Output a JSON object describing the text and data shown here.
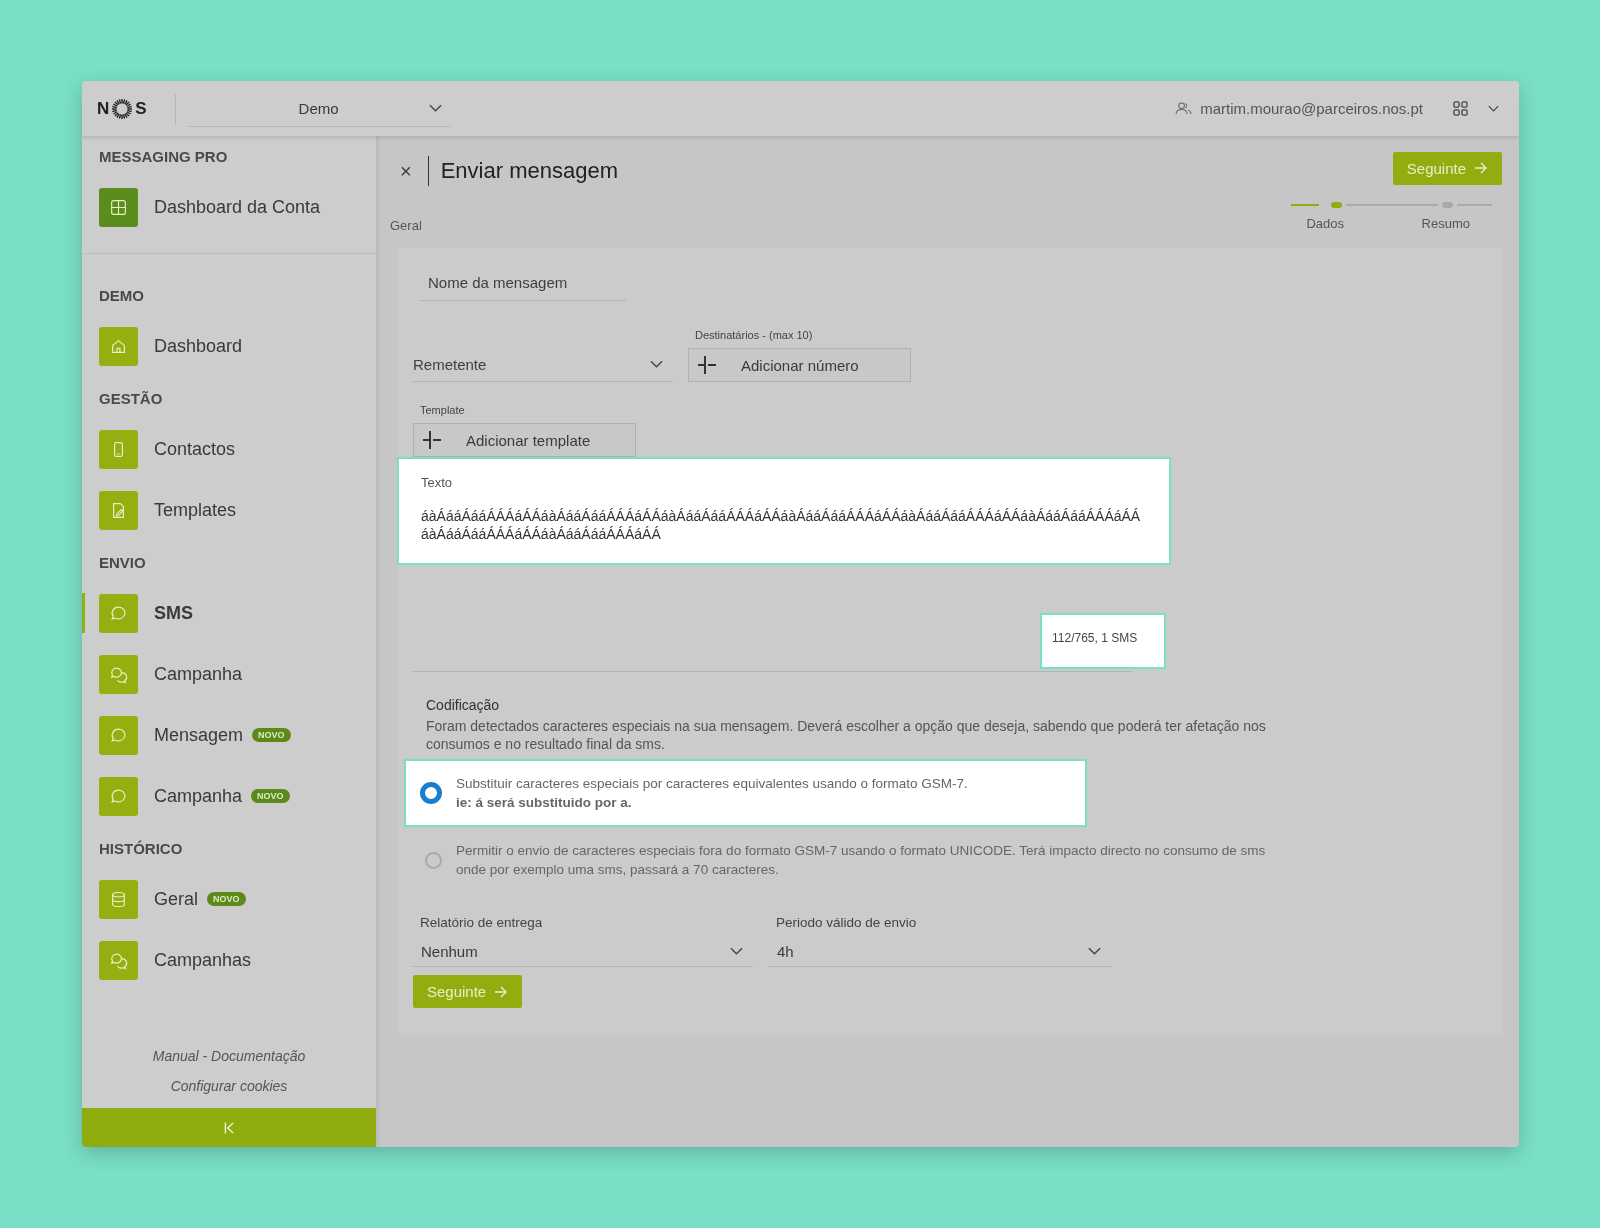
{
  "header": {
    "logo": {
      "left": "N",
      "right": "S"
    },
    "account_select": {
      "value": "Demo"
    },
    "user_email": "martim.mourao@parceiros.nos.pt"
  },
  "sidebar": {
    "sections": [
      {
        "title": "MESSAGING PRO",
        "items": [
          {
            "label": "Dashboard da Conta",
            "selected": false,
            "color": "#5b8c1e"
          }
        ]
      },
      {
        "title": "DEMO",
        "items": [
          {
            "label": "Dashboard",
            "selected": false,
            "color": "#94b010"
          }
        ]
      },
      {
        "title": "GESTÃO",
        "items": [
          {
            "label": "Contactos",
            "selected": false,
            "color": "#94b010"
          },
          {
            "label": "Templates",
            "selected": false,
            "color": "#94b010"
          }
        ]
      },
      {
        "title": "ENVIO",
        "items": [
          {
            "label": "SMS",
            "selected": true,
            "color": "#94b010"
          },
          {
            "label": "Campanha",
            "selected": false,
            "color": "#94b010"
          },
          {
            "label": "Mensagem",
            "badge": "NOVO",
            "selected": false,
            "color": "#94b010"
          },
          {
            "label": "Campanha",
            "badge": "NOVO",
            "selected": false,
            "color": "#94b010"
          }
        ]
      },
      {
        "title": "HISTÓRICO",
        "items": [
          {
            "label": "Geral",
            "badge": "NOVO",
            "selected": false,
            "color": "#94b010"
          },
          {
            "label": "Campanhas",
            "selected": false,
            "color": "#94b010"
          }
        ]
      }
    ],
    "footer_links": [
      "Manual - Documentação",
      "Configurar cookies"
    ]
  },
  "page": {
    "close_glyph": "×",
    "title": "Enviar mensagem",
    "next_button": "Seguinte",
    "steps": [
      {
        "label": "Geral",
        "done": true,
        "active": false
      },
      {
        "label": "Dados",
        "done": false,
        "active": true
      },
      {
        "label": "Resumo",
        "done": false,
        "active": false
      }
    ]
  },
  "form": {
    "name_field": {
      "placeholder": "Nome da mensagem"
    },
    "sender_select": {
      "placeholder": "Remetente"
    },
    "recipients": {
      "label": "Destinatários - (max 10)",
      "button": "Adicionar número"
    },
    "template": {
      "label": "Template",
      "button": "Adicionar template"
    },
    "text": {
      "label": "Texto",
      "value": "áàÁááÁááÁÁÁáÁÁáàÁááÁááÁÁÁáÁÁáàÁááÁááÁÁÁáÁÁáàÁááÁááÁÁÁáÁÁáàÁááÁááÁÁÁáÁÁáàÁááÁááÁÁÁáÁÁáàÁááÁááÁÁÁáÁÁáàÁááÁááÁÁÁáÁÁ",
      "highlighted": true
    },
    "counter": {
      "text": "112/765, 1 SMS",
      "highlighted": true
    },
    "encoding": {
      "title": "Codificação",
      "description": "Foram detectados caracteres especiais na sua mensagem. Deverá escolher a opção que deseja, sabendo que poderá ter afetação nos consumos e no resultado final da sms.",
      "options": [
        {
          "text": "Substituir caracteres especiais por caracteres equivalentes usando o formato GSM-7.",
          "note": "ie: á será substituido por a.",
          "selected": true,
          "highlighted": true
        },
        {
          "text": "Permitir o envio de caracteres especiais fora do formato GSM-7 usando o formato UNICODE. Terá impacto directo no consumo de sms onde por exemplo uma sms, passará a 70 caracteres.",
          "selected": false,
          "highlighted": false
        }
      ]
    },
    "delivery_report": {
      "label": "Relatório de entrega",
      "value": "Nenhum"
    },
    "valid_period": {
      "label": "Periodo válido de envio",
      "value": "4h"
    },
    "submit_button": "Seguinte"
  }
}
